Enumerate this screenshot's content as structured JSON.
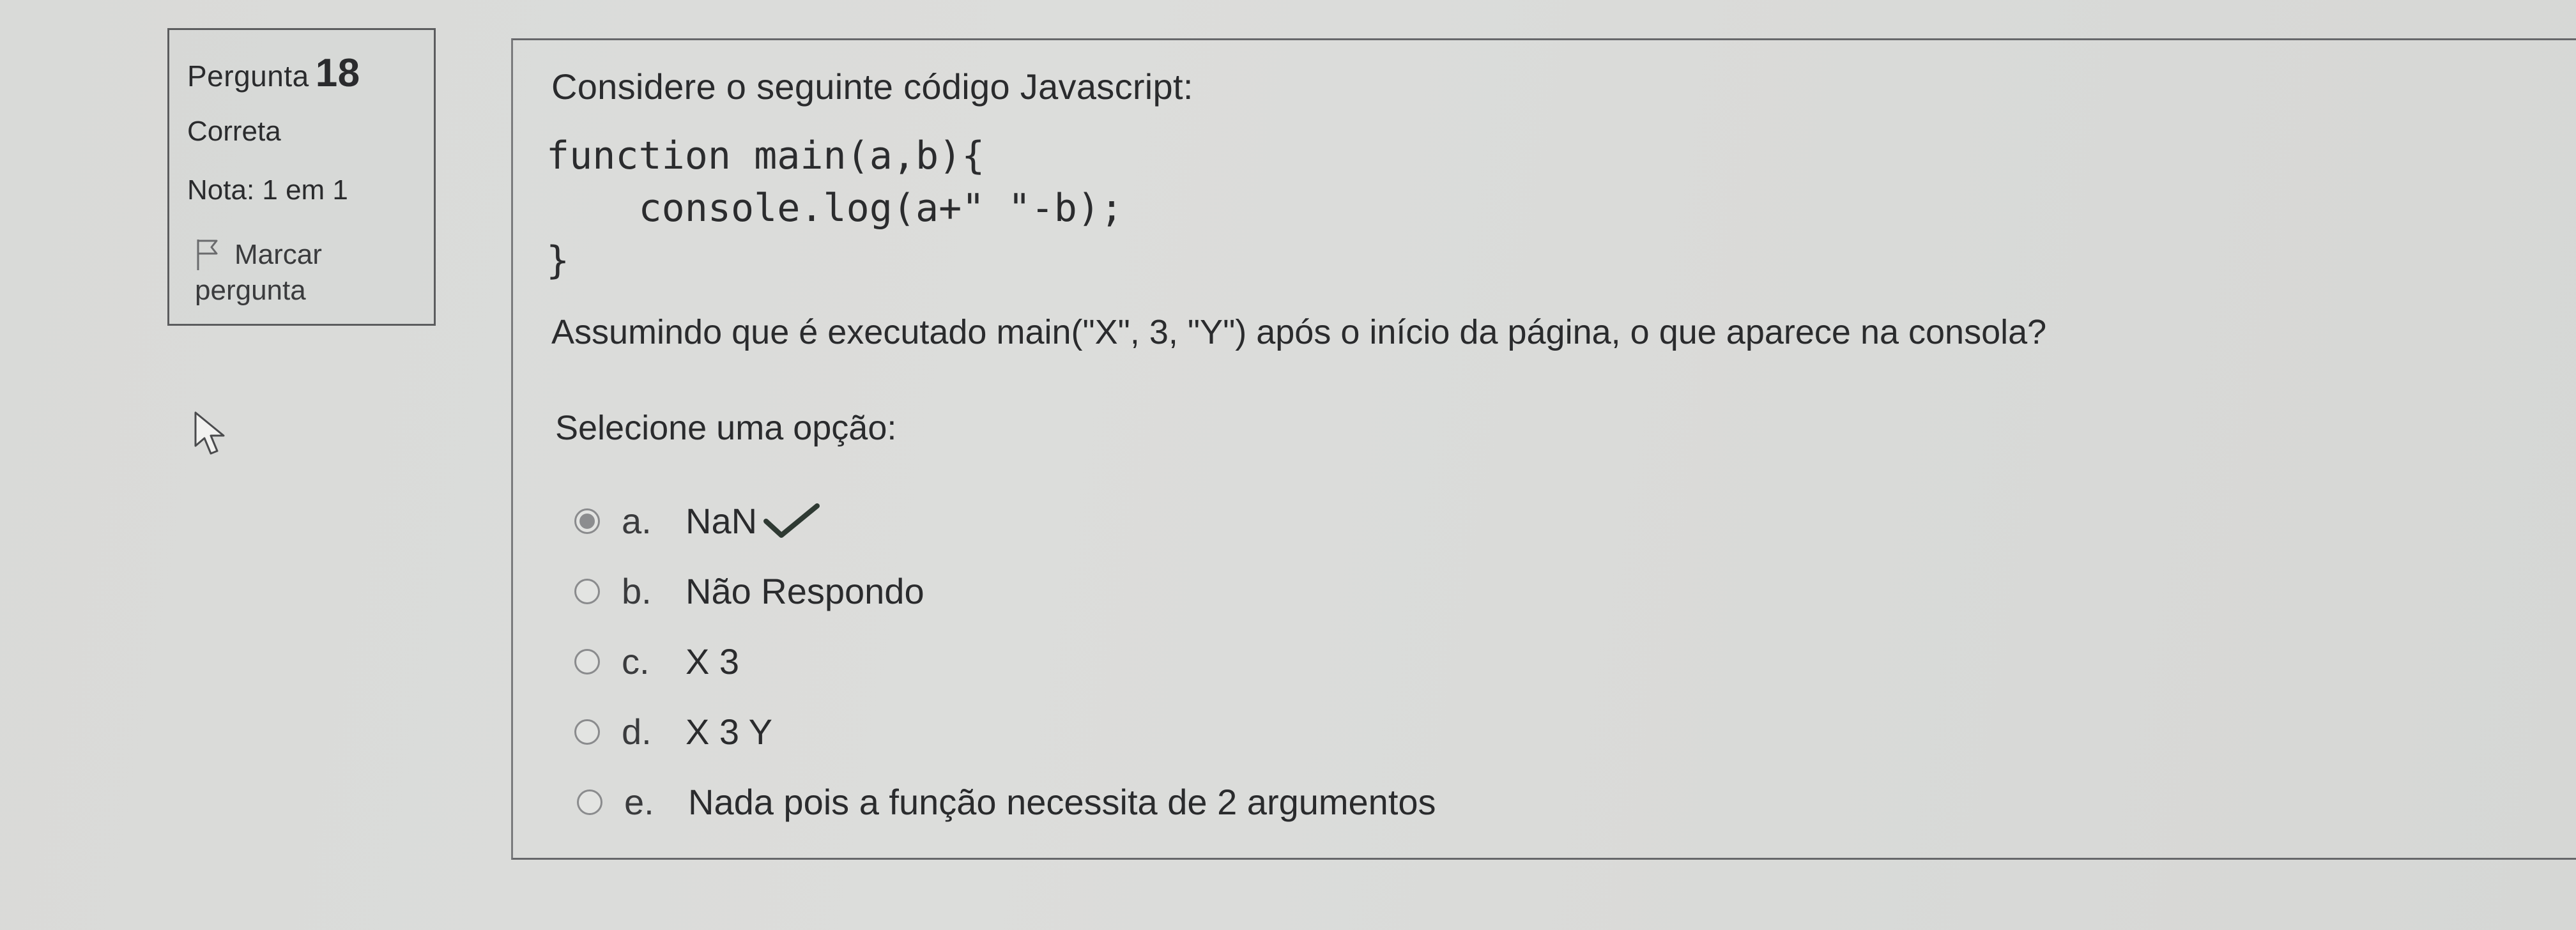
{
  "info": {
    "question_prefix": "Pergunta",
    "question_number": "18",
    "state": "Correta",
    "grade": "Nota: 1 em 1",
    "flag_line1": "Marcar",
    "flag_line2": "pergunta"
  },
  "question": {
    "prompt": "Considere o seguinte código Javascript:",
    "code_lines": [
      "function main(a,b){",
      "    console.log(a+\" \"-b);",
      "}"
    ],
    "text": "Assumindo que é executado main(\"X\", 3, \"Y\") após o início da página, o que aparece na consola?",
    "select_label": "Selecione uma opção:"
  },
  "options": [
    {
      "letter": "a.",
      "text": "NaN",
      "selected": true,
      "correct": true
    },
    {
      "letter": "b.",
      "text": "Não Respondo",
      "selected": false
    },
    {
      "letter": "c.",
      "text": "X 3",
      "selected": false
    },
    {
      "letter": "d.",
      "text": "X 3 Y",
      "selected": false
    },
    {
      "letter": "e.",
      "text": "Nada pois a função necessita de 2 argumentos",
      "selected": false
    }
  ],
  "icons": {
    "flag": "flag-outline-icon",
    "correct": "checkmark-icon",
    "cursor": "mouse-pointer-icon"
  },
  "colors": {
    "correct_check": "#2f3a33",
    "text": "#2a2b2d"
  }
}
